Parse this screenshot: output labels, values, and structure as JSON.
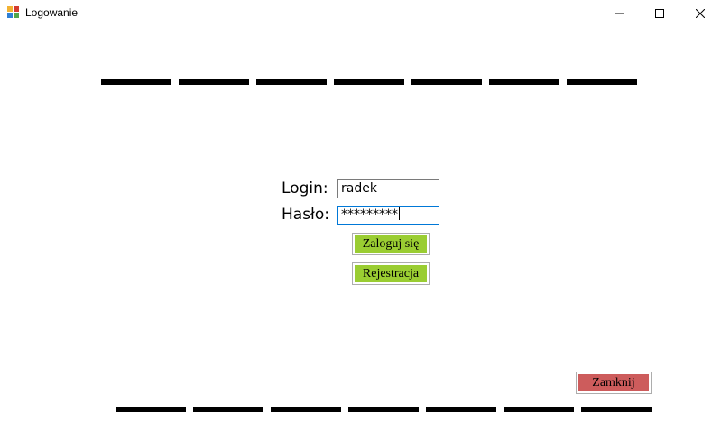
{
  "window": {
    "title": "Logowanie",
    "icon": "winforms-app-icon",
    "controls": [
      "minimize-icon",
      "maximize-icon",
      "close-icon"
    ]
  },
  "form": {
    "login_label": "Login:",
    "password_label": "Hasło:",
    "login_value": "radek",
    "password_value": "*********"
  },
  "buttons": {
    "login": "Zaloguj się",
    "register": "Rejestracja",
    "close": "Zamknij"
  },
  "colors": {
    "green_button": "#9acd32",
    "red_button": "#cd5c5c",
    "focus_border": "#0078d7"
  }
}
